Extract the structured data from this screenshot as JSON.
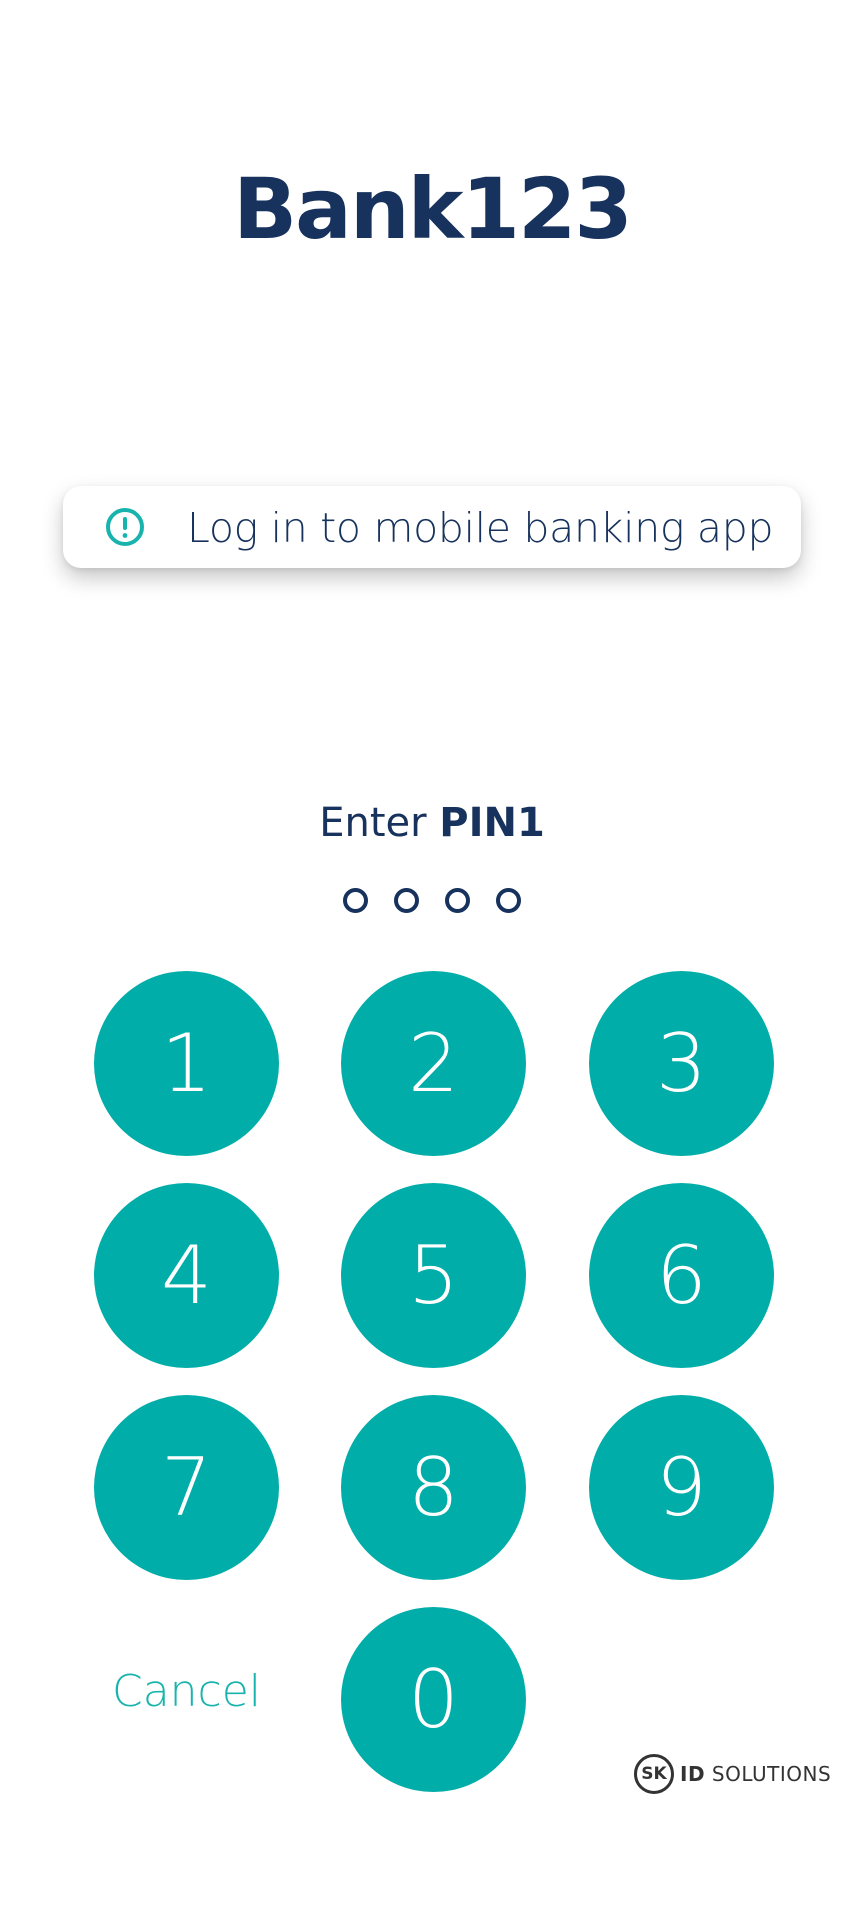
{
  "header": {
    "bank_name": "Bank123"
  },
  "banner": {
    "icon": "exclamation-circle-icon",
    "message": "Log in to mobile banking app"
  },
  "pin_prompt": {
    "prefix": "Enter ",
    "pin_name": "PIN1",
    "digits_entered": 0,
    "digits_total": 4
  },
  "keypad": {
    "keys": [
      "1",
      "2",
      "3",
      "4",
      "5",
      "6",
      "7",
      "8",
      "9",
      "0"
    ],
    "cancel_label": "Cancel"
  },
  "brand": {
    "logo_text": "SK",
    "id_text": "ID",
    "solutions_text": "SOLUTIONS"
  },
  "colors": {
    "primary": "#17325c",
    "accent": "#00ada8",
    "background": "#ffffff"
  }
}
